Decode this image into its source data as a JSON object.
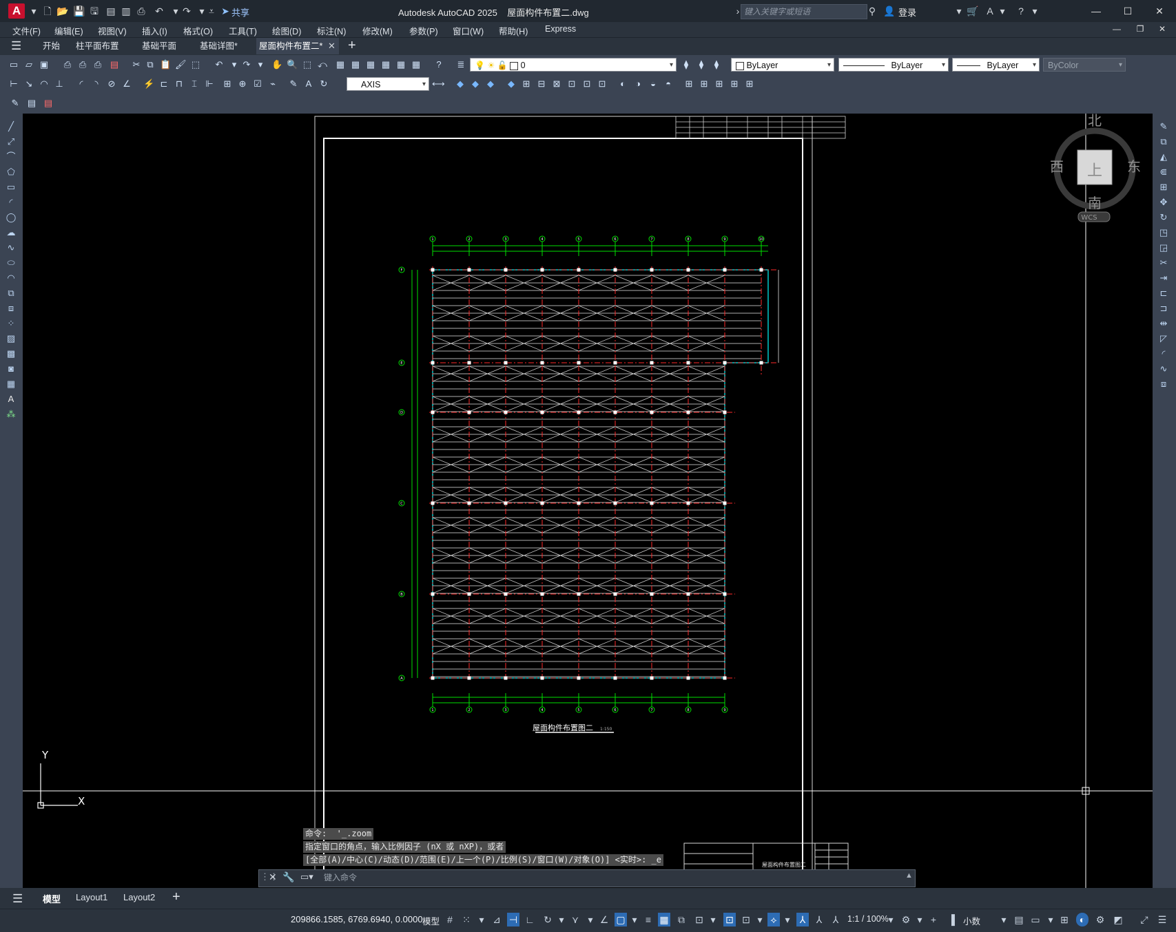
{
  "app": {
    "title": "Autodesk AutoCAD 2025    屋面构件布置二.dwg",
    "logo": "A",
    "share_label": "共享",
    "search_placeholder": "键入关键字或短语",
    "login_label": "登录"
  },
  "menu": [
    "文件(F)",
    "编辑(E)",
    "视图(V)",
    "插入(I)",
    "格式(O)",
    "工具(T)",
    "绘图(D)",
    "标注(N)",
    "修改(M)",
    "参数(P)",
    "窗口(W)",
    "帮助(H)",
    "Express"
  ],
  "doc_tabs": [
    {
      "label": "开始"
    },
    {
      "label": "柱平面布置"
    },
    {
      "label": "基础平面"
    },
    {
      "label": "基础详图*"
    },
    {
      "label": "屋面构件布置二*",
      "active": true
    }
  ],
  "toolbar": {
    "layer_value": "0",
    "color_value": "ByLayer",
    "linetype_value": "ByLayer",
    "lineweight_value": "ByLayer",
    "plotstyle_value": "ByColor",
    "dimstyle_value": "AXIS"
  },
  "viewcube": {
    "north": "北",
    "south": "南",
    "east": "东",
    "west": "西",
    "top": "上",
    "wcs": "WCS"
  },
  "drawing": {
    "caption": "屋面构件布置图二",
    "caption_scale": "1:150",
    "grid_x_labels": [
      "1",
      "2",
      "3",
      "4",
      "5",
      "6",
      "7",
      "8",
      "9",
      "10"
    ],
    "grid_y_labels": [
      "A",
      "B",
      "C",
      "D",
      "E",
      "F"
    ],
    "title_block_name": "屋面构件布置图二"
  },
  "ucs": {
    "x": "X",
    "y": "Y"
  },
  "command": {
    "history": [
      "命令:  '_.zoom",
      "指定窗口的角点，输入比例因子 (nX 或 nXP)，或者",
      "[全部(A)/中心(C)/动态(D)/范围(E)/上一个(P)/比例(S)/窗口(W)/对象(O)] <实时>: _e"
    ],
    "input_placeholder": "键入命令"
  },
  "layout_tabs": [
    {
      "label": "模型",
      "active": true
    },
    {
      "label": "Layout1"
    },
    {
      "label": "Layout2"
    }
  ],
  "status": {
    "coords": "209866.1585, 6769.6940, 0.0000",
    "model_label": "模型",
    "scale_label": "1:1 / 100%",
    "units_label": "小数"
  }
}
